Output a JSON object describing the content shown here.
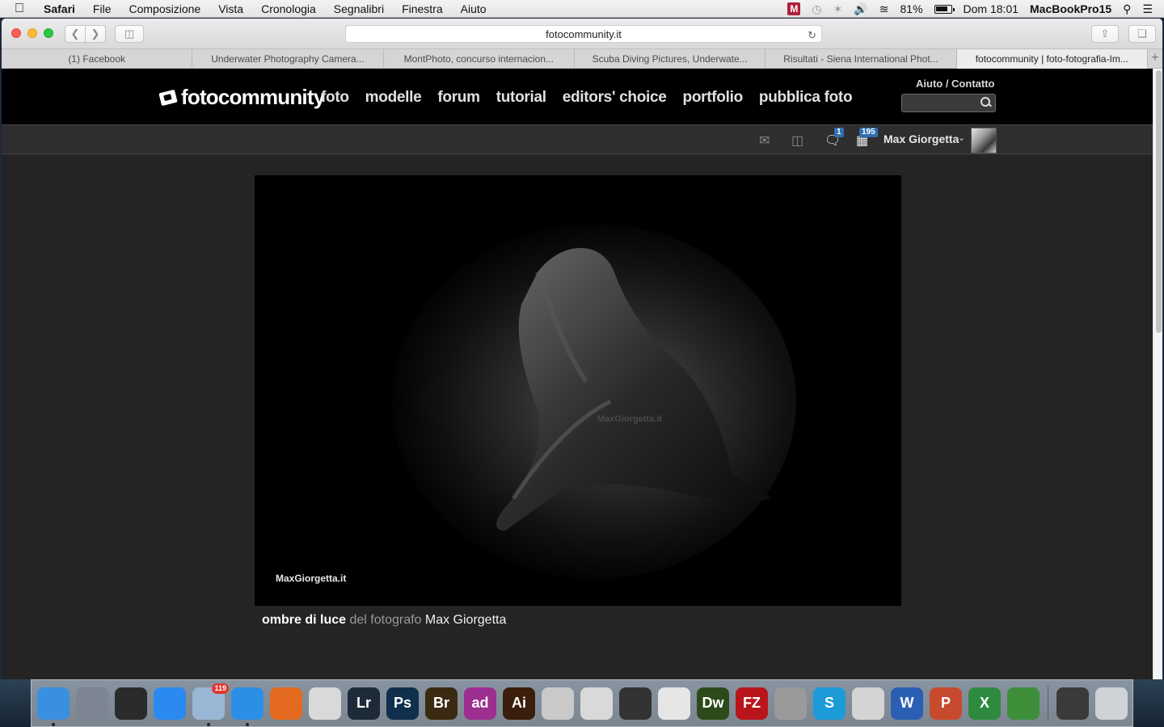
{
  "menubar": {
    "app": "Safari",
    "items": [
      "File",
      "Composizione",
      "Vista",
      "Cronologia",
      "Segnalibri",
      "Finestra",
      "Aiuto"
    ],
    "battery": "81%",
    "clock": "Dom 18:01",
    "computer": "MacBookPro15",
    "m_badge": "M"
  },
  "browser": {
    "url": "fotocommunity.it",
    "tabs": [
      "(1) Facebook",
      "Underwater Photography Camera...",
      "MontPhoto, concurso internacion...",
      "Scuba Diving Pictures, Underwate...",
      "Risultati - Siena International Phot...",
      "fotocommunity | foto-fotografia-Im..."
    ],
    "active_tab": 5,
    "newtab_label": "+"
  },
  "site": {
    "logo": "fotocommunity",
    "nav": [
      "foto",
      "modelle",
      "forum",
      "tutorial",
      "editors' choice",
      "portfolio",
      "pubblica foto"
    ],
    "help_link": "Aiuto / Contatto",
    "search_placeholder": ""
  },
  "userbar": {
    "comments_count": "1",
    "photos_count": "195",
    "user_name": "Max Giorgetta"
  },
  "photo": {
    "watermark_center": "MaxGiorgetta.it",
    "watermark_logo": "MaxGiorgetta.it",
    "title": "ombre di luce",
    "by_label": " del fotografo ",
    "author": "Max Giorgetta"
  },
  "dock": {
    "mail_badge": "119",
    "apps": [
      {
        "name": "finder",
        "label": "",
        "color": "#3b8fe0"
      },
      {
        "name": "launchpad",
        "label": "",
        "color": "#7c8591"
      },
      {
        "name": "photo-browser",
        "label": "",
        "color": "#2b2b2b"
      },
      {
        "name": "app-store",
        "label": "",
        "color": "#2a8af0"
      },
      {
        "name": "mail",
        "label": "",
        "color": "#9ab7d6"
      },
      {
        "name": "safari",
        "label": "",
        "color": "#2c8fe6"
      },
      {
        "name": "firefox",
        "label": "",
        "color": "#e36a1f"
      },
      {
        "name": "chrome",
        "label": "",
        "color": "#d9d9d9"
      },
      {
        "name": "lightroom",
        "label": "Lr",
        "color": "#1d2a38"
      },
      {
        "name": "photoshop",
        "label": "Ps",
        "color": "#0f2f4d"
      },
      {
        "name": "bridge",
        "label": "Br",
        "color": "#3b2a12"
      },
      {
        "name": "audition",
        "label": "ad",
        "color": "#9c2f8f"
      },
      {
        "name": "illustrator",
        "label": "Ai",
        "color": "#3a1d0a"
      },
      {
        "name": "preview",
        "label": "",
        "color": "#c9c9c9"
      },
      {
        "name": "stamp",
        "label": "",
        "color": "#d9d9d9"
      },
      {
        "name": "claquette",
        "label": "",
        "color": "#333"
      },
      {
        "name": "palette",
        "label": "",
        "color": "#e6e6e6"
      },
      {
        "name": "dreamweaver",
        "label": "Dw",
        "color": "#2c4a1a"
      },
      {
        "name": "filezilla",
        "label": "FZ",
        "color": "#b8161c"
      },
      {
        "name": "calculator",
        "label": "",
        "color": "#9a9a9a"
      },
      {
        "name": "skype",
        "label": "S",
        "color": "#1c9bd8"
      },
      {
        "name": "preview-3d",
        "label": "",
        "color": "#d4d4d4"
      },
      {
        "name": "word",
        "label": "W",
        "color": "#2b5fb3"
      },
      {
        "name": "powerpoint",
        "label": "P",
        "color": "#c84a2e"
      },
      {
        "name": "excel",
        "label": "X",
        "color": "#2d8a3e"
      },
      {
        "name": "downloader",
        "label": "",
        "color": "#3f8e3a"
      }
    ],
    "printer_color": "#3a3a3a",
    "trash_color": "#cfd3d8"
  }
}
